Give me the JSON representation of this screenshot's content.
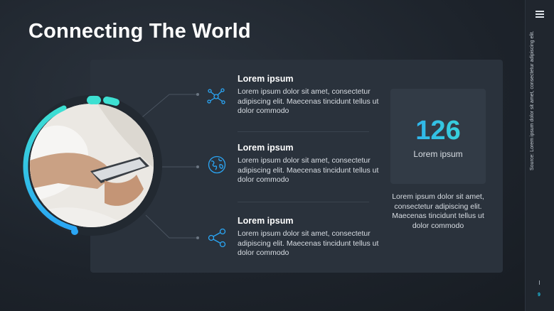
{
  "slide": {
    "title": "Connecting The World",
    "page_number": "9",
    "source_note": "Source: Lorem ipsum dolor sit amet, consectetur adipiscing elit."
  },
  "items": [
    {
      "title": "Lorem ipsum",
      "text": "Lorem ipsum dolor sit amet, consectetur adipiscing elit. Maecenas tincidunt tellus ut dolor commodo",
      "icon": "network-icon"
    },
    {
      "title": "Lorem ipsum",
      "text": "Lorem ipsum dolor sit amet, consectetur adipiscing elit. Maecenas tincidunt tellus ut dolor commodo",
      "icon": "globe-icon"
    },
    {
      "title": "Lorem ipsum",
      "text": "Lorem ipsum dolor sit amet, consectetur adipiscing elit. Maecenas tincidunt tellus ut dolor commodo",
      "icon": "share-icon"
    }
  ],
  "stat": {
    "value": "126",
    "label": "Lorem ipsum",
    "description": "Lorem ipsum dolor sit amet, consectetur adipiscing elit. Maecenas tincidunt tellus ut dolor commodo"
  },
  "colors": {
    "accent_blue": "#2aa6f5",
    "accent_cyan": "#3de0d2",
    "background": "#1d232b",
    "panel": "#2a323c"
  }
}
